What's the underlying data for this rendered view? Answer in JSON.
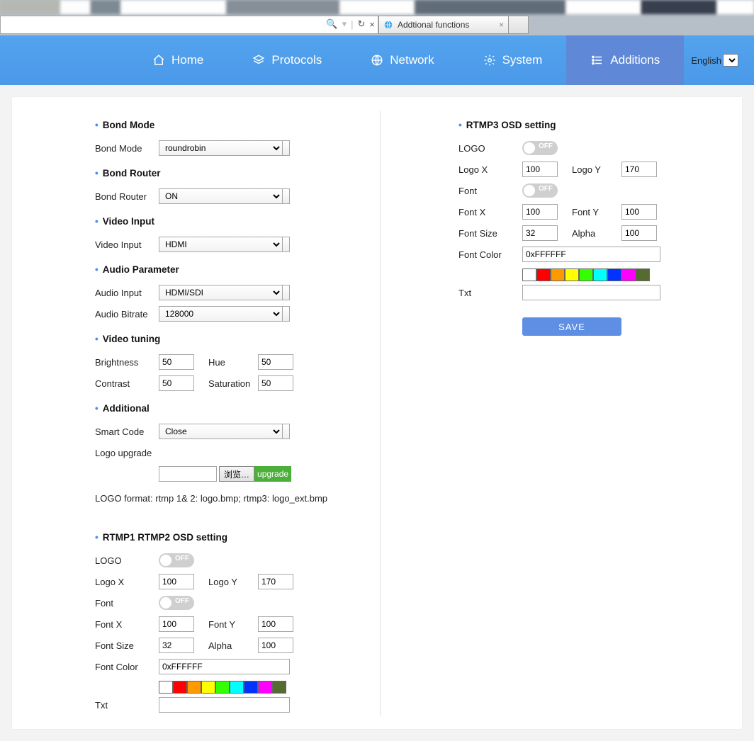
{
  "browser": {
    "search_prefix": "🔍",
    "search_suffix": "▾",
    "refresh": "↻",
    "close_x": "×",
    "tab_title": "Addtional functions"
  },
  "nav": {
    "home": "Home",
    "protocols": "Protocols",
    "network": "Network",
    "system": "System",
    "additions": "Additions",
    "lang_label": "English"
  },
  "left": {
    "bond_mode_h": "Bond Mode",
    "bond_mode_l": "Bond Mode",
    "bond_mode_v": "roundrobin",
    "bond_router_h": "Bond Router",
    "bond_router_l": "Bond Router",
    "bond_router_v": "ON",
    "video_input_h": "Video Input",
    "video_input_l": "Video Input",
    "video_input_v": "HDMI",
    "audio_param_h": "Audio Parameter",
    "audio_input_l": "Audio Input",
    "audio_input_v": "HDMI/SDI",
    "audio_bitrate_l": "Audio Bitrate",
    "audio_bitrate_v": "128000",
    "video_tuning_h": "Video tuning",
    "brightness_l": "Brightness",
    "brightness_v": "50",
    "hue_l": "Hue",
    "hue_v": "50",
    "contrast_l": "Contrast",
    "contrast_v": "50",
    "saturation_l": "Saturation",
    "saturation_v": "50",
    "additional_h": "Additional",
    "smartcode_l": "Smart Code",
    "smartcode_v": "Close",
    "logo_upgrade_l": "Logo upgrade",
    "browse_btn": "浏览…",
    "upgrade_btn": "upgrade",
    "logo_format": "LOGO format:  rtmp 1& 2: logo.bmp; rtmp3: logo_ext.bmp"
  },
  "osd1": {
    "title": "RTMP1 RTMP2 OSD setting",
    "logo_l": "LOGO",
    "off": "OFF",
    "logox_l": "Logo X",
    "logox_v": "100",
    "logoy_l": "Logo Y",
    "logoy_v": "170",
    "font_l": "Font",
    "fontx_l": "Font X",
    "fontx_v": "100",
    "fonty_l": "Font Y",
    "fonty_v": "100",
    "fontsize_l": "Font Size",
    "fontsize_v": "32",
    "alpha_l": "Alpha",
    "alpha_v": "100",
    "fontcolor_l": "Font Color",
    "fontcolor_v": "0xFFFFFF",
    "txt_l": "Txt",
    "txt_v": ""
  },
  "osd3": {
    "title": "RTMP3 OSD setting",
    "logo_l": "LOGO",
    "off": "OFF",
    "logox_l": "Logo X",
    "logox_v": "100",
    "logoy_l": "Logo Y",
    "logoy_v": "170",
    "font_l": "Font",
    "fontx_l": "Font X",
    "fontx_v": "100",
    "fonty_l": "Font Y",
    "fonty_v": "100",
    "fontsize_l": "Font Size",
    "fontsize_v": "32",
    "alpha_l": "Alpha",
    "alpha_v": "100",
    "fontcolor_l": "Font Color",
    "fontcolor_v": "0xFFFFFF",
    "txt_l": "Txt",
    "txt_v": ""
  },
  "colors": [
    "#ffffff",
    "#ff0000",
    "#ff9900",
    "#ffff00",
    "#33ff00",
    "#00ffff",
    "#0033ff",
    "#ff00ff",
    "#556b2f"
  ],
  "save": "SAVE"
}
